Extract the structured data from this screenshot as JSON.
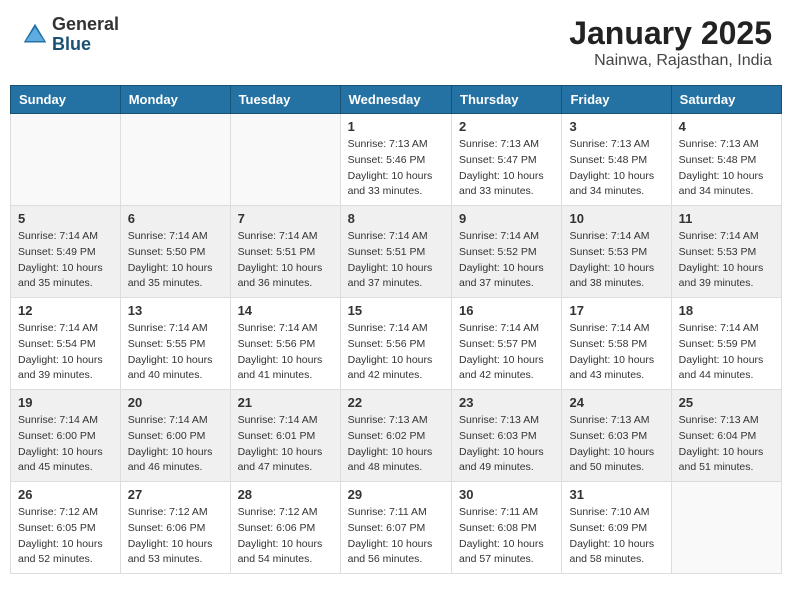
{
  "header": {
    "logo_general": "General",
    "logo_blue": "Blue",
    "month_title": "January 2025",
    "location": "Nainwa, Rajasthan, India"
  },
  "weekdays": [
    "Sunday",
    "Monday",
    "Tuesday",
    "Wednesday",
    "Thursday",
    "Friday",
    "Saturday"
  ],
  "weeks": [
    {
      "shaded": false,
      "days": [
        {
          "num": "",
          "empty": true
        },
        {
          "num": "",
          "empty": true
        },
        {
          "num": "",
          "empty": true
        },
        {
          "num": "1",
          "sunrise": "7:13 AM",
          "sunset": "5:46 PM",
          "daylight": "10 hours and 33 minutes."
        },
        {
          "num": "2",
          "sunrise": "7:13 AM",
          "sunset": "5:47 PM",
          "daylight": "10 hours and 33 minutes."
        },
        {
          "num": "3",
          "sunrise": "7:13 AM",
          "sunset": "5:48 PM",
          "daylight": "10 hours and 34 minutes."
        },
        {
          "num": "4",
          "sunrise": "7:13 AM",
          "sunset": "5:48 PM",
          "daylight": "10 hours and 34 minutes."
        }
      ]
    },
    {
      "shaded": true,
      "days": [
        {
          "num": "5",
          "sunrise": "7:14 AM",
          "sunset": "5:49 PM",
          "daylight": "10 hours and 35 minutes."
        },
        {
          "num": "6",
          "sunrise": "7:14 AM",
          "sunset": "5:50 PM",
          "daylight": "10 hours and 35 minutes."
        },
        {
          "num": "7",
          "sunrise": "7:14 AM",
          "sunset": "5:51 PM",
          "daylight": "10 hours and 36 minutes."
        },
        {
          "num": "8",
          "sunrise": "7:14 AM",
          "sunset": "5:51 PM",
          "daylight": "10 hours and 37 minutes."
        },
        {
          "num": "9",
          "sunrise": "7:14 AM",
          "sunset": "5:52 PM",
          "daylight": "10 hours and 37 minutes."
        },
        {
          "num": "10",
          "sunrise": "7:14 AM",
          "sunset": "5:53 PM",
          "daylight": "10 hours and 38 minutes."
        },
        {
          "num": "11",
          "sunrise": "7:14 AM",
          "sunset": "5:53 PM",
          "daylight": "10 hours and 39 minutes."
        }
      ]
    },
    {
      "shaded": false,
      "days": [
        {
          "num": "12",
          "sunrise": "7:14 AM",
          "sunset": "5:54 PM",
          "daylight": "10 hours and 39 minutes."
        },
        {
          "num": "13",
          "sunrise": "7:14 AM",
          "sunset": "5:55 PM",
          "daylight": "10 hours and 40 minutes."
        },
        {
          "num": "14",
          "sunrise": "7:14 AM",
          "sunset": "5:56 PM",
          "daylight": "10 hours and 41 minutes."
        },
        {
          "num": "15",
          "sunrise": "7:14 AM",
          "sunset": "5:56 PM",
          "daylight": "10 hours and 42 minutes."
        },
        {
          "num": "16",
          "sunrise": "7:14 AM",
          "sunset": "5:57 PM",
          "daylight": "10 hours and 42 minutes."
        },
        {
          "num": "17",
          "sunrise": "7:14 AM",
          "sunset": "5:58 PM",
          "daylight": "10 hours and 43 minutes."
        },
        {
          "num": "18",
          "sunrise": "7:14 AM",
          "sunset": "5:59 PM",
          "daylight": "10 hours and 44 minutes."
        }
      ]
    },
    {
      "shaded": true,
      "days": [
        {
          "num": "19",
          "sunrise": "7:14 AM",
          "sunset": "6:00 PM",
          "daylight": "10 hours and 45 minutes."
        },
        {
          "num": "20",
          "sunrise": "7:14 AM",
          "sunset": "6:00 PM",
          "daylight": "10 hours and 46 minutes."
        },
        {
          "num": "21",
          "sunrise": "7:14 AM",
          "sunset": "6:01 PM",
          "daylight": "10 hours and 47 minutes."
        },
        {
          "num": "22",
          "sunrise": "7:13 AM",
          "sunset": "6:02 PM",
          "daylight": "10 hours and 48 minutes."
        },
        {
          "num": "23",
          "sunrise": "7:13 AM",
          "sunset": "6:03 PM",
          "daylight": "10 hours and 49 minutes."
        },
        {
          "num": "24",
          "sunrise": "7:13 AM",
          "sunset": "6:03 PM",
          "daylight": "10 hours and 50 minutes."
        },
        {
          "num": "25",
          "sunrise": "7:13 AM",
          "sunset": "6:04 PM",
          "daylight": "10 hours and 51 minutes."
        }
      ]
    },
    {
      "shaded": false,
      "days": [
        {
          "num": "26",
          "sunrise": "7:12 AM",
          "sunset": "6:05 PM",
          "daylight": "10 hours and 52 minutes."
        },
        {
          "num": "27",
          "sunrise": "7:12 AM",
          "sunset": "6:06 PM",
          "daylight": "10 hours and 53 minutes."
        },
        {
          "num": "28",
          "sunrise": "7:12 AM",
          "sunset": "6:06 PM",
          "daylight": "10 hours and 54 minutes."
        },
        {
          "num": "29",
          "sunrise": "7:11 AM",
          "sunset": "6:07 PM",
          "daylight": "10 hours and 56 minutes."
        },
        {
          "num": "30",
          "sunrise": "7:11 AM",
          "sunset": "6:08 PM",
          "daylight": "10 hours and 57 minutes."
        },
        {
          "num": "31",
          "sunrise": "7:10 AM",
          "sunset": "6:09 PM",
          "daylight": "10 hours and 58 minutes."
        },
        {
          "num": "",
          "empty": true
        }
      ]
    }
  ],
  "labels": {
    "sunrise_label": "Sunrise:",
    "sunset_label": "Sunset:",
    "daylight_label": "Daylight:"
  }
}
